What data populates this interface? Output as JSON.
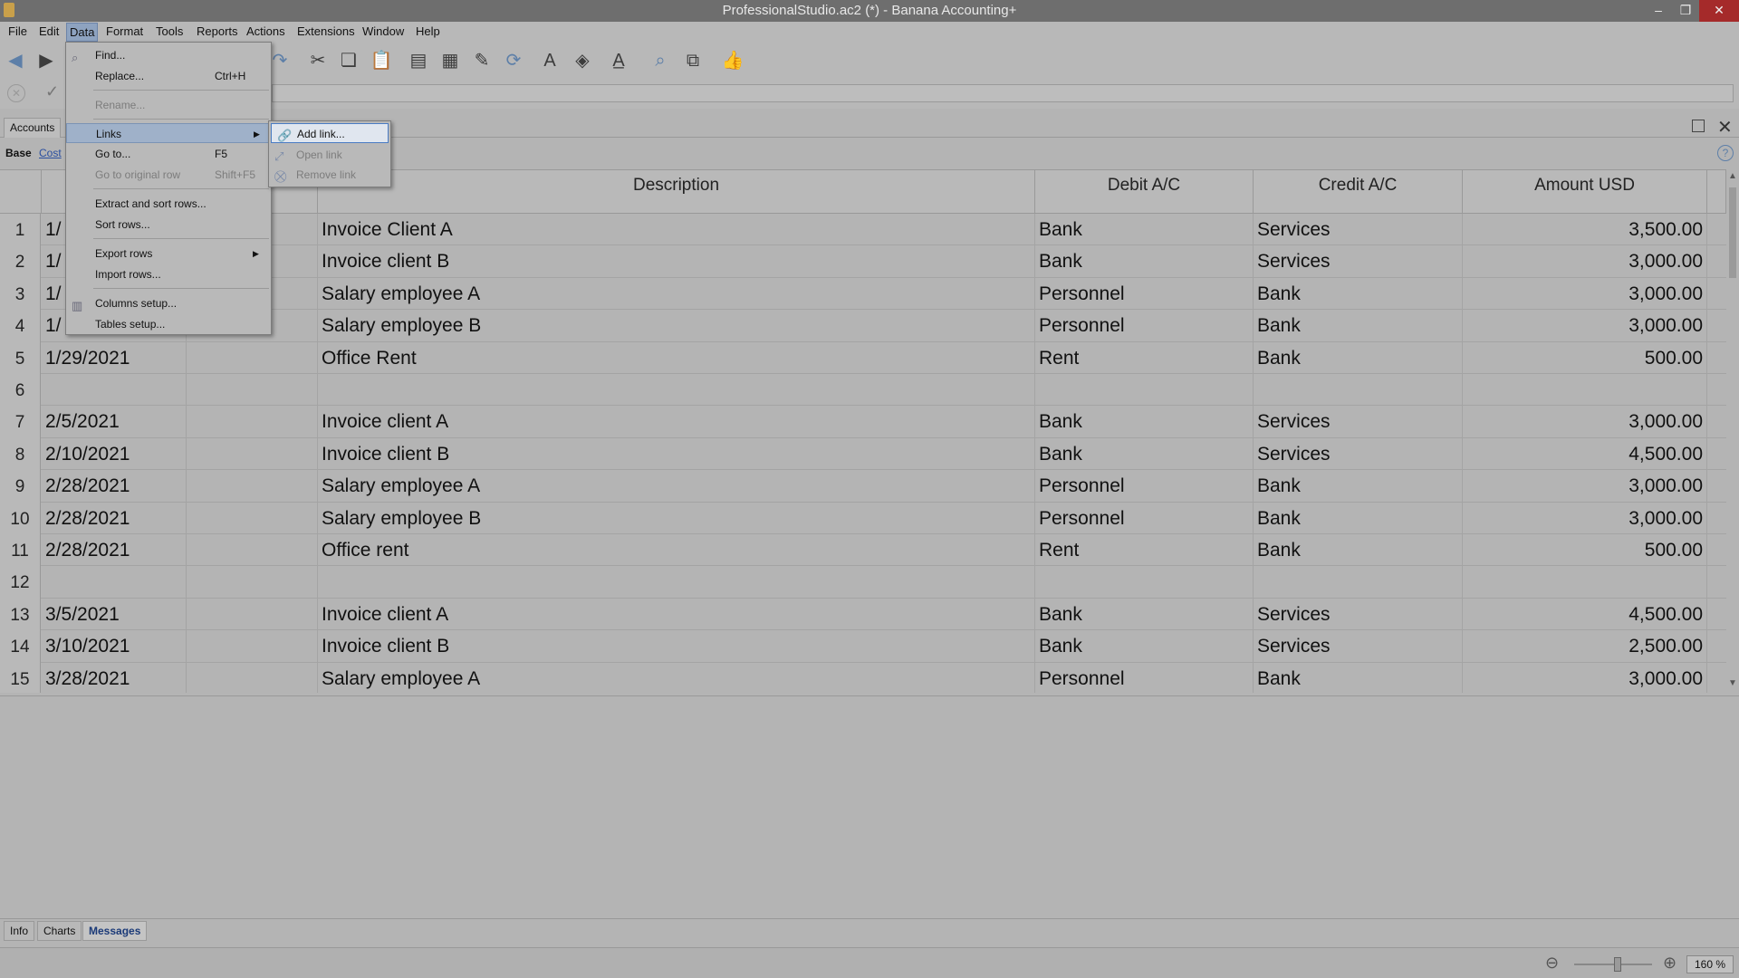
{
  "window": {
    "title": "ProfessionalStudio.ac2 (*) - Banana Accounting+"
  },
  "menubar": [
    "File",
    "Edit",
    "Data",
    "Format",
    "Tools",
    "Reports",
    "Actions",
    "Extensions",
    "Window",
    "Help"
  ],
  "tabs": {
    "accounts": "Accounts"
  },
  "view": {
    "base": "Base",
    "cost": "Cost"
  },
  "columns": {
    "description": "Description",
    "debit": "Debit A/C",
    "credit": "Credit A/C",
    "amount": "Amount USD"
  },
  "rows": [
    {
      "n": "1",
      "date": "1/",
      "desc": "Invoice Client A",
      "debit": "Bank",
      "credit": "Services",
      "amount": "3,500.00"
    },
    {
      "n": "2",
      "date": "1/",
      "desc": "Invoice client B",
      "debit": "Bank",
      "credit": "Services",
      "amount": "3,000.00"
    },
    {
      "n": "3",
      "date": "1/",
      "desc": "Salary employee A",
      "debit": "Personnel",
      "credit": "Bank",
      "amount": "3,000.00"
    },
    {
      "n": "4",
      "date": "1/",
      "desc": "Salary employee B",
      "debit": "Personnel",
      "credit": "Bank",
      "amount": "3,000.00"
    },
    {
      "n": "5",
      "date": "1/29/2021",
      "desc": "Office Rent",
      "debit": "Rent",
      "credit": "Bank",
      "amount": "500.00"
    },
    {
      "n": "6",
      "date": "",
      "desc": "",
      "debit": "",
      "credit": "",
      "amount": ""
    },
    {
      "n": "7",
      "date": "2/5/2021",
      "desc": "Invoice client A",
      "debit": "Bank",
      "credit": "Services",
      "amount": "3,000.00"
    },
    {
      "n": "8",
      "date": "2/10/2021",
      "desc": "Invoice client B",
      "debit": "Bank",
      "credit": "Services",
      "amount": "4,500.00"
    },
    {
      "n": "9",
      "date": "2/28/2021",
      "desc": "Salary employee A",
      "debit": "Personnel",
      "credit": "Bank",
      "amount": "3,000.00"
    },
    {
      "n": "10",
      "date": "2/28/2021",
      "desc": "Salary employee B",
      "debit": "Personnel",
      "credit": "Bank",
      "amount": "3,000.00"
    },
    {
      "n": "11",
      "date": "2/28/2021",
      "desc": "Office rent",
      "debit": "Rent",
      "credit": "Bank",
      "amount": "500.00"
    },
    {
      "n": "12",
      "date": "",
      "desc": "",
      "debit": "",
      "credit": "",
      "amount": ""
    },
    {
      "n": "13",
      "date": "3/5/2021",
      "desc": "Invoice client A",
      "debit": "Bank",
      "credit": "Services",
      "amount": "4,500.00"
    },
    {
      "n": "14",
      "date": "3/10/2021",
      "desc": "Invoice client B",
      "debit": "Bank",
      "credit": "Services",
      "amount": "2,500.00"
    },
    {
      "n": "15",
      "date": "3/28/2021",
      "desc": "Salary employee A",
      "debit": "Personnel",
      "credit": "Bank",
      "amount": "3,000.00"
    }
  ],
  "data_menu": {
    "find": "Find...",
    "replace": "Replace...",
    "replace_shortcut": "Ctrl+H",
    "rename": "Rename...",
    "links": "Links",
    "goto": "Go to...",
    "goto_shortcut": "F5",
    "goto_original": "Go to original row",
    "goto_original_shortcut": "Shift+F5",
    "extract_sort": "Extract and sort rows...",
    "sort_rows": "Sort rows...",
    "export_rows": "Export rows",
    "import_rows": "Import rows...",
    "columns_setup": "Columns setup...",
    "tables_setup": "Tables setup..."
  },
  "links_submenu": {
    "add": "Add link...",
    "open": "Open link",
    "remove": "Remove link"
  },
  "bottom_tabs": [
    "Info",
    "Charts",
    "Messages"
  ],
  "zoom": "160 %",
  "colors": {
    "accent": "#4a7cc4",
    "menu_highlight": "#9fb1c9"
  }
}
